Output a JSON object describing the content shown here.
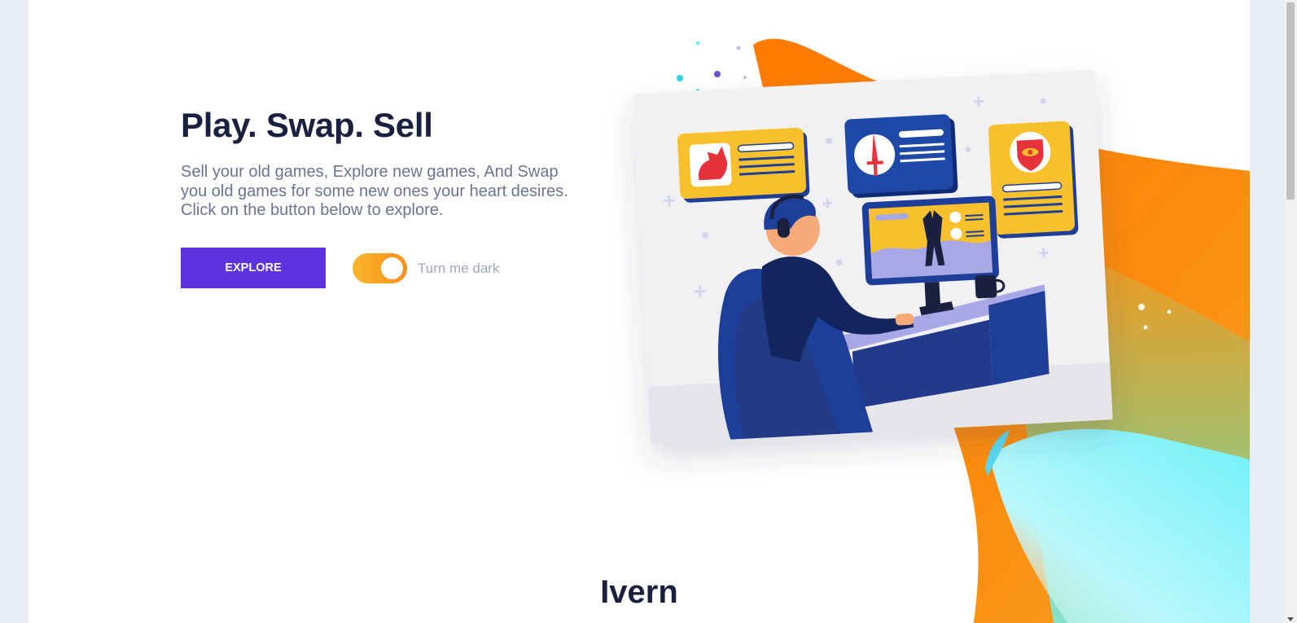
{
  "hero": {
    "title": "Play. Swap. Sell",
    "description": "Sell your old games, Explore new games, And Swap you old games for some new ones your heart desires. Click on the button below to explore.",
    "explore_label": "EXPLORE",
    "dark_toggle_label": "Turn me dark",
    "dark_mode_on": true
  },
  "brand": {
    "name": "Ivern"
  },
  "colors": {
    "primary": "#5d33e0",
    "toggle": "#f7901e",
    "heading": "#1a2140",
    "body_text": "#6c7391",
    "blob_orange": "#fc8a0f",
    "blob_cyan": "#7ef2fa"
  },
  "illustration": {
    "icons": [
      "dragon-icon",
      "sword-icon",
      "eye-shield-icon",
      "headset-icon",
      "monitor-icon",
      "coffee-mug-icon"
    ]
  }
}
